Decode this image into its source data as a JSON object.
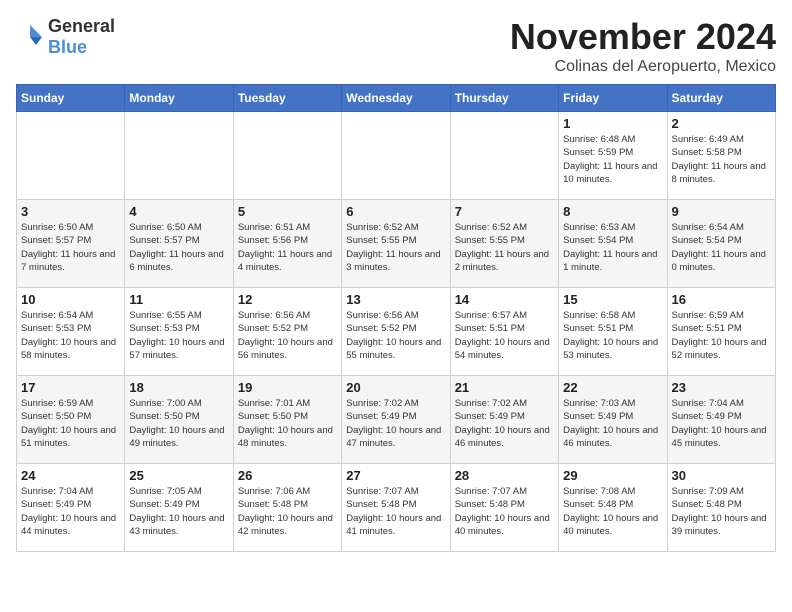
{
  "logo": {
    "text_general": "General",
    "text_blue": "Blue"
  },
  "header": {
    "month": "November 2024",
    "location": "Colinas del Aeropuerto, Mexico"
  },
  "weekdays": [
    "Sunday",
    "Monday",
    "Tuesday",
    "Wednesday",
    "Thursday",
    "Friday",
    "Saturday"
  ],
  "weeks": [
    [
      {
        "day": "",
        "info": ""
      },
      {
        "day": "",
        "info": ""
      },
      {
        "day": "",
        "info": ""
      },
      {
        "day": "",
        "info": ""
      },
      {
        "day": "",
        "info": ""
      },
      {
        "day": "1",
        "info": "Sunrise: 6:48 AM\nSunset: 5:59 PM\nDaylight: 11 hours and 10 minutes."
      },
      {
        "day": "2",
        "info": "Sunrise: 6:49 AM\nSunset: 5:58 PM\nDaylight: 11 hours and 8 minutes."
      }
    ],
    [
      {
        "day": "3",
        "info": "Sunrise: 6:50 AM\nSunset: 5:57 PM\nDaylight: 11 hours and 7 minutes."
      },
      {
        "day": "4",
        "info": "Sunrise: 6:50 AM\nSunset: 5:57 PM\nDaylight: 11 hours and 6 minutes."
      },
      {
        "day": "5",
        "info": "Sunrise: 6:51 AM\nSunset: 5:56 PM\nDaylight: 11 hours and 4 minutes."
      },
      {
        "day": "6",
        "info": "Sunrise: 6:52 AM\nSunset: 5:55 PM\nDaylight: 11 hours and 3 minutes."
      },
      {
        "day": "7",
        "info": "Sunrise: 6:52 AM\nSunset: 5:55 PM\nDaylight: 11 hours and 2 minutes."
      },
      {
        "day": "8",
        "info": "Sunrise: 6:53 AM\nSunset: 5:54 PM\nDaylight: 11 hours and 1 minute."
      },
      {
        "day": "9",
        "info": "Sunrise: 6:54 AM\nSunset: 5:54 PM\nDaylight: 11 hours and 0 minutes."
      }
    ],
    [
      {
        "day": "10",
        "info": "Sunrise: 6:54 AM\nSunset: 5:53 PM\nDaylight: 10 hours and 58 minutes."
      },
      {
        "day": "11",
        "info": "Sunrise: 6:55 AM\nSunset: 5:53 PM\nDaylight: 10 hours and 57 minutes."
      },
      {
        "day": "12",
        "info": "Sunrise: 6:56 AM\nSunset: 5:52 PM\nDaylight: 10 hours and 56 minutes."
      },
      {
        "day": "13",
        "info": "Sunrise: 6:56 AM\nSunset: 5:52 PM\nDaylight: 10 hours and 55 minutes."
      },
      {
        "day": "14",
        "info": "Sunrise: 6:57 AM\nSunset: 5:51 PM\nDaylight: 10 hours and 54 minutes."
      },
      {
        "day": "15",
        "info": "Sunrise: 6:58 AM\nSunset: 5:51 PM\nDaylight: 10 hours and 53 minutes."
      },
      {
        "day": "16",
        "info": "Sunrise: 6:59 AM\nSunset: 5:51 PM\nDaylight: 10 hours and 52 minutes."
      }
    ],
    [
      {
        "day": "17",
        "info": "Sunrise: 6:59 AM\nSunset: 5:50 PM\nDaylight: 10 hours and 51 minutes."
      },
      {
        "day": "18",
        "info": "Sunrise: 7:00 AM\nSunset: 5:50 PM\nDaylight: 10 hours and 49 minutes."
      },
      {
        "day": "19",
        "info": "Sunrise: 7:01 AM\nSunset: 5:50 PM\nDaylight: 10 hours and 48 minutes."
      },
      {
        "day": "20",
        "info": "Sunrise: 7:02 AM\nSunset: 5:49 PM\nDaylight: 10 hours and 47 minutes."
      },
      {
        "day": "21",
        "info": "Sunrise: 7:02 AM\nSunset: 5:49 PM\nDaylight: 10 hours and 46 minutes."
      },
      {
        "day": "22",
        "info": "Sunrise: 7:03 AM\nSunset: 5:49 PM\nDaylight: 10 hours and 46 minutes."
      },
      {
        "day": "23",
        "info": "Sunrise: 7:04 AM\nSunset: 5:49 PM\nDaylight: 10 hours and 45 minutes."
      }
    ],
    [
      {
        "day": "24",
        "info": "Sunrise: 7:04 AM\nSunset: 5:49 PM\nDaylight: 10 hours and 44 minutes."
      },
      {
        "day": "25",
        "info": "Sunrise: 7:05 AM\nSunset: 5:49 PM\nDaylight: 10 hours and 43 minutes."
      },
      {
        "day": "26",
        "info": "Sunrise: 7:06 AM\nSunset: 5:48 PM\nDaylight: 10 hours and 42 minutes."
      },
      {
        "day": "27",
        "info": "Sunrise: 7:07 AM\nSunset: 5:48 PM\nDaylight: 10 hours and 41 minutes."
      },
      {
        "day": "28",
        "info": "Sunrise: 7:07 AM\nSunset: 5:48 PM\nDaylight: 10 hours and 40 minutes."
      },
      {
        "day": "29",
        "info": "Sunrise: 7:08 AM\nSunset: 5:48 PM\nDaylight: 10 hours and 40 minutes."
      },
      {
        "day": "30",
        "info": "Sunrise: 7:09 AM\nSunset: 5:48 PM\nDaylight: 10 hours and 39 minutes."
      }
    ]
  ]
}
